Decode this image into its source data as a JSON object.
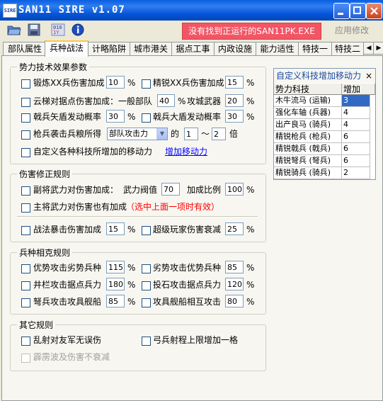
{
  "window": {
    "app_icon_text": "SIRE",
    "title": "SAN11 SIRE v1.07"
  },
  "toolbar": {
    "status_text": "没有找到正运行的SAN11PK.EXE",
    "apply_label": "应用修改",
    "icons": [
      "open-folder-icon",
      "save-disk-icon",
      "settings-icon",
      "info-icon"
    ]
  },
  "tabs": [
    "部队属性",
    "兵种战法",
    "计略陷阱",
    "城市港关",
    "据点工事",
    "内政设施",
    "能力适性",
    "特技一",
    "特技二"
  ],
  "active_tab": "兵种战法",
  "g1": {
    "title": "势力技术效果参数",
    "r1a_label": "锻炼XX兵伤害加成",
    "r1a_val": "10",
    "r1a_unit": "%",
    "r1b_label": "精锐XX兵伤害加成",
    "r1b_val": "15",
    "r1b_unit": "%",
    "r2a_label": "云梯对据点伤害加成：一般部队",
    "r2a_val": "40",
    "r2a_unit": "%",
    "r2b_label": "攻城武器",
    "r2b_val": "20",
    "r2b_unit": "%",
    "r3a_label": "戟兵矢盾发动概率",
    "r3a_val": "30",
    "r3a_unit": "%",
    "r3b_label": "戟兵大盾发动概率",
    "r3b_val": "30",
    "r3b_unit": "%",
    "r4_label": "枪兵袭击兵粮所得",
    "r4_select": "部队攻击力",
    "r4_of": "的",
    "r4_min": "1",
    "r4_tilde": "～",
    "r4_max": "2",
    "r4_unit": "倍",
    "r5_label": "自定义各种科技所增加的移动力",
    "r5_link": "增加移动力"
  },
  "g2": {
    "title": "伤害修正规则",
    "r1_label": "副将武力对伤害加成：",
    "r1_threshold_label": "武力阀值",
    "r1_threshold": "70",
    "r1_ratio_label": "加成比例",
    "r1_ratio": "100",
    "r1_unit": "%",
    "r2_label": "主将武力对伤害也有加成",
    "r2_note": "（选中上面一项时有效）",
    "r3a_label": "战法暴击伤害加成",
    "r3a_val": "15",
    "r3a_unit": "%",
    "r3b_label": "超级玩家伤害衰减",
    "r3b_val": "25",
    "r3b_unit": "%"
  },
  "g3": {
    "title": "兵种相克规则",
    "r1a_label": "优势攻击劣势兵种",
    "r1a_val": "115",
    "r1a_unit": "%",
    "r1b_label": "劣势攻击优势兵种",
    "r1b_val": "85",
    "r1b_unit": "%",
    "r2a_label": "井栏攻击据点兵力",
    "r2a_val": "180",
    "r2a_unit": "%",
    "r2b_label": "投石攻击据点兵力",
    "r2b_val": "120",
    "r2b_unit": "%",
    "r3a_label": "弩兵攻击攻具舰船",
    "r3a_val": "85",
    "r3a_unit": "%",
    "r3b_label": "攻具舰船相互攻击",
    "r3b_val": "80",
    "r3b_unit": "%"
  },
  "g4": {
    "title": "其它规则",
    "r1a_label": "乱射对友军无误伤",
    "r1b_label": "弓兵射程上限增加一格",
    "r2_label": "霹雳波及伤害不衰减"
  },
  "tech_table": {
    "title": "自定义科技增加移动力",
    "close": "×",
    "col_tech": "势力科技",
    "col_add": "增加",
    "rows": [
      {
        "tech": "木牛流马 (运输)",
        "add": "3"
      },
      {
        "tech": "强化车轴 (兵器)",
        "add": "4"
      },
      {
        "tech": "出产良马 (骑兵)",
        "add": "4"
      },
      {
        "tech": "精锐枪兵 (枪兵)",
        "add": "6"
      },
      {
        "tech": "精锐戟兵 (戟兵)",
        "add": "6"
      },
      {
        "tech": "精锐弩兵 (弩兵)",
        "add": "6"
      },
      {
        "tech": "精锐骑兵 (骑兵)",
        "add": "2"
      }
    ]
  }
}
